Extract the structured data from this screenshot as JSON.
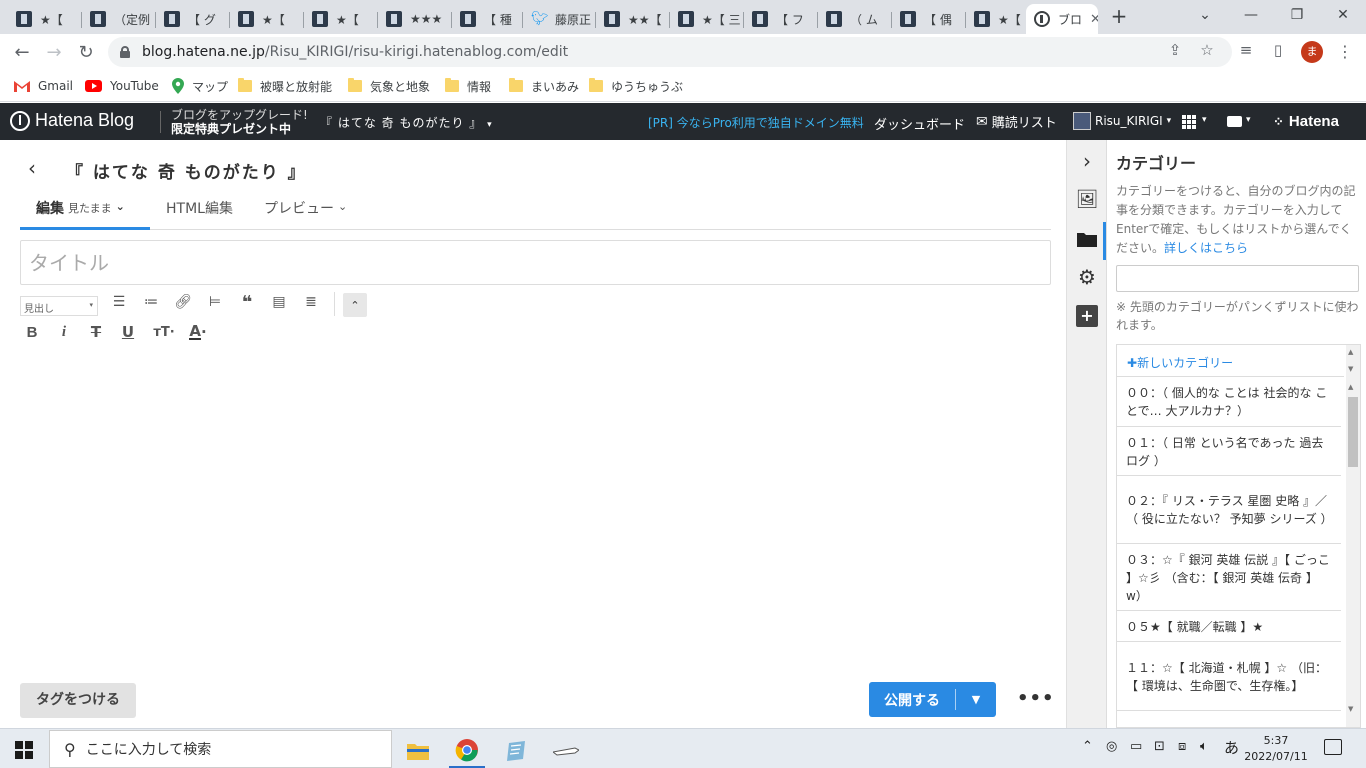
{
  "browser": {
    "tabs": [
      {
        "label": "★【",
        "kind": "hb"
      },
      {
        "label": "（定例",
        "kind": "hb"
      },
      {
        "label": "【 グ",
        "kind": "hb"
      },
      {
        "label": "★【",
        "kind": "hb"
      },
      {
        "label": "★【",
        "kind": "hb"
      },
      {
        "label": "★★★",
        "kind": "hb"
      },
      {
        "label": "【 種",
        "kind": "hb"
      },
      {
        "label": "藤原正",
        "kind": "twitter"
      },
      {
        "label": "★★【",
        "kind": "hb"
      },
      {
        "label": "★【 三",
        "kind": "hb"
      },
      {
        "label": "【 フ",
        "kind": "hb"
      },
      {
        "label": "（ ム",
        "kind": "hb"
      },
      {
        "label": "【 偶",
        "kind": "hb"
      },
      {
        "label": "★【",
        "kind": "hb"
      },
      {
        "label": "ブロ",
        "kind": "hatena",
        "active": true
      }
    ],
    "url_host": "blog.hatena.ne.jp",
    "url_path": "/Risu_KIRIGI/risu-kirigi.hatenablog.com/edit",
    "profile_initial": "ま",
    "bookmarks": [
      {
        "label": "Gmail",
        "icon": "gmail-icon"
      },
      {
        "label": "YouTube",
        "icon": "youtube-icon"
      },
      {
        "label": "マップ",
        "icon": "maps-icon"
      },
      {
        "label": "被曝と放射能",
        "icon": "folder-icon"
      },
      {
        "label": "気象と地象",
        "icon": "folder-icon"
      },
      {
        "label": "情報",
        "icon": "folder-icon"
      },
      {
        "label": "まいあみ",
        "icon": "folder-icon"
      },
      {
        "label": "ゆうちゅうぶ",
        "icon": "folder-icon"
      }
    ]
  },
  "hatena_header": {
    "logo": "Hatena Blog",
    "upgrade_line1": "ブログをアップグレード!",
    "upgrade_line2": "限定特典プレゼント中",
    "blog_name": "『 はてな 奇 ものがたり 』",
    "pr_text": "[PR] 今ならPro利用で独自ドメイン無料",
    "dashboard": "ダッシュボード",
    "reader": "購読リスト",
    "user": "Risu_KIRIGI",
    "brand": "Hatena"
  },
  "editor": {
    "blog_title": "『 はてな 奇 ものがたり 』",
    "tabs": [
      {
        "label": "編集",
        "sub": "見たまま"
      },
      {
        "label": "HTML編集",
        "sub": ""
      },
      {
        "label": "プレビュー",
        "sub": ""
      }
    ],
    "title_placeholder": "タイトル",
    "format_select": "見出し",
    "tag_button": "タグをつける",
    "publish_button": "公開する"
  },
  "category_panel": {
    "title": "カテゴリー",
    "description": "カテゴリーをつけると、自分のブログ内の記事を分類できます。カテゴリーを入力してEnterで確定、もしくはリストから選んでください。",
    "more_link": "詳しくはこちら",
    "note": "※ 先頭のカテゴリーがパンくずリストに使われます。",
    "new_category": "新しいカテゴリー",
    "items": [
      "００：（ 個人的な ことは 社会的な ことで… 大アルカナ？）",
      "０１：（ 日常 という名であった 過去ログ ）",
      "０２：『 リス・テラス 星圏 史略 』／（ 役に立たない？ 予知夢 シリーズ ）",
      "０３：☆『 銀河 英雄 伝説 』【 ごっこ 】☆彡 （含む：【 銀河 英雄 伝奇 】w）",
      "０５★【 就職／転職 】★",
      "１１：☆【 北海道・札幌 】☆ （旧：【 環境は、生命圏で、生存権。】"
    ]
  },
  "taskbar": {
    "search_placeholder": "ここに入力して検索",
    "time": "5:37",
    "date": "2022/07/11",
    "ime": "あ"
  }
}
